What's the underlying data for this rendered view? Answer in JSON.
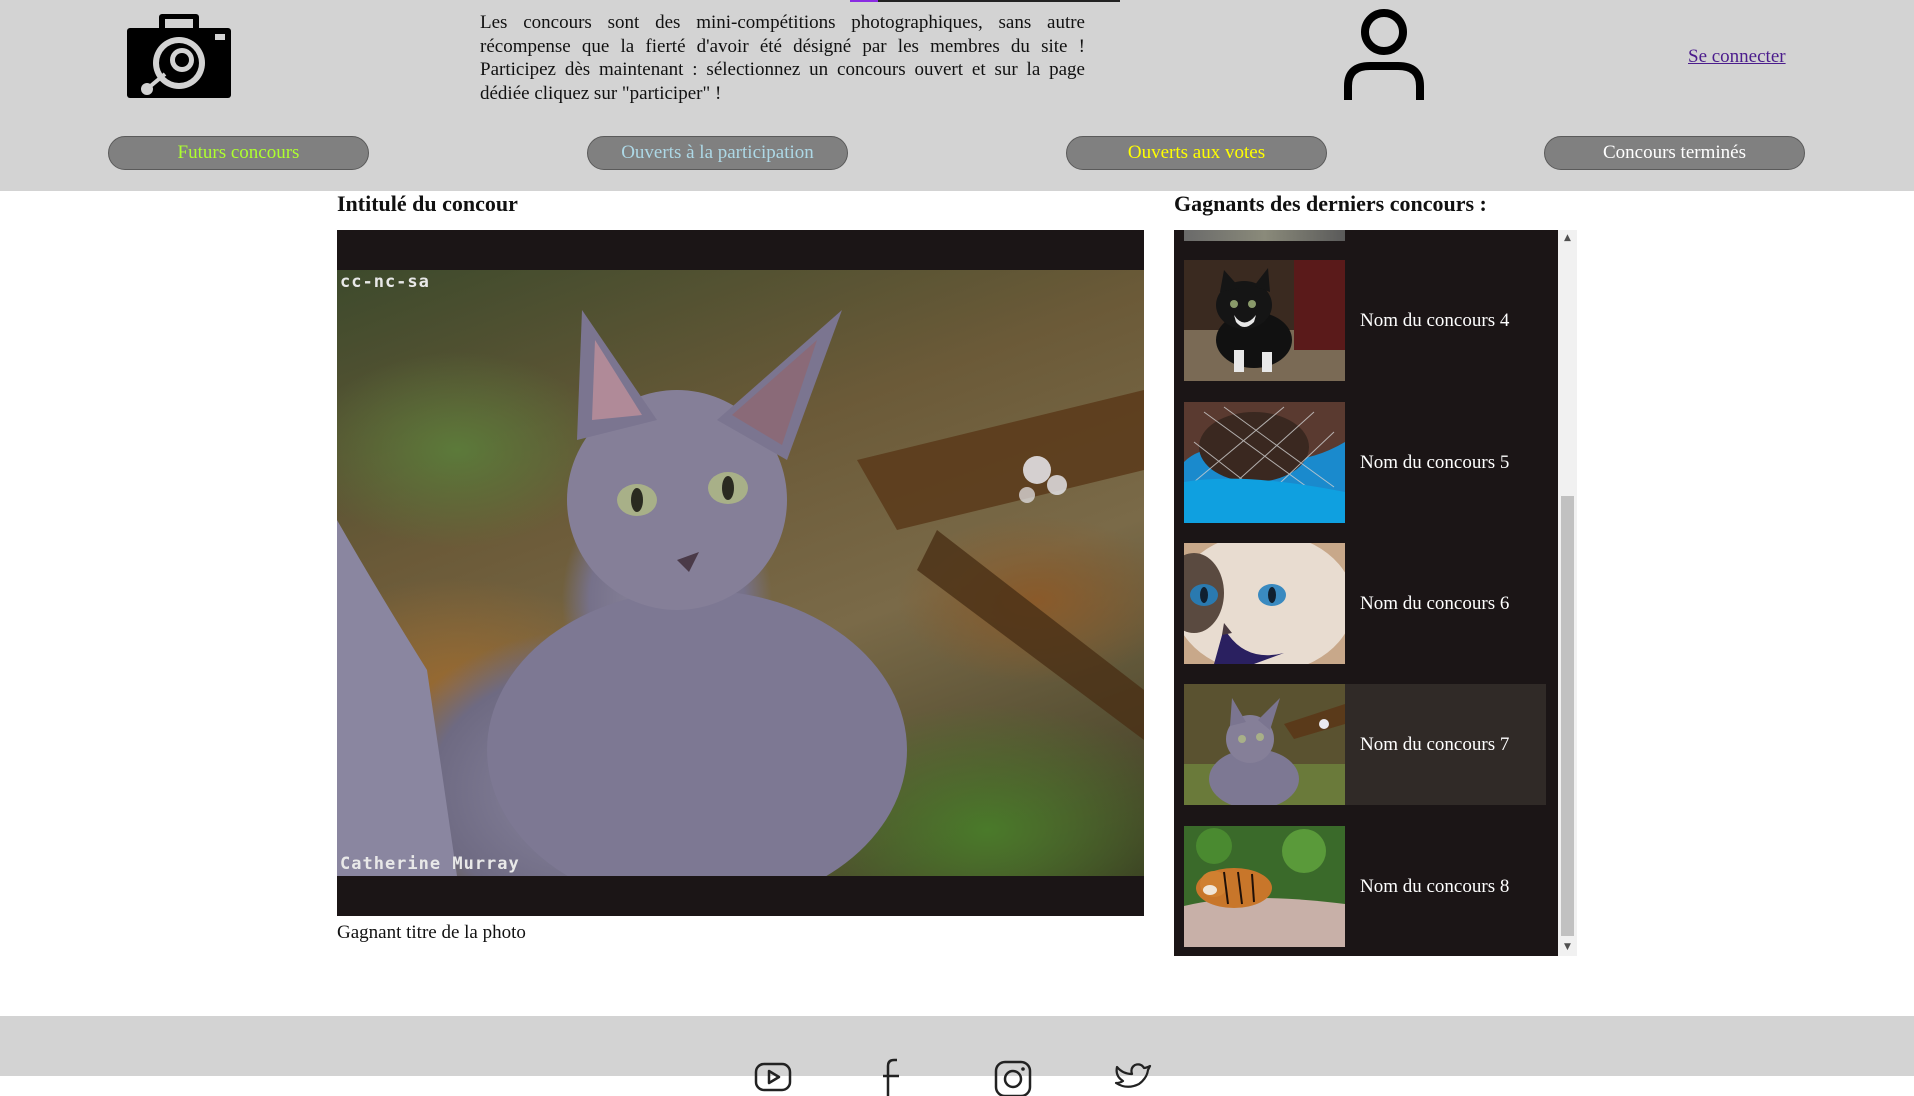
{
  "header": {
    "intro_text": "Les concours sont des mini-compétitions photographiques, sans autre récompense que la fierté d'avoir été désigné par les membres du site ! Participez dès maintenant : sélectionnez un concours ouvert et sur la page dédiée cliquez sur \"participer\" !",
    "login_label": "Se connecter",
    "logo_icon": "camera-icon",
    "user_icon": "user-icon"
  },
  "nav": {
    "tabs": [
      {
        "label": "Futurs concours",
        "color": "#adff2f"
      },
      {
        "label": "Ouverts à la participation",
        "color": "#add8e6"
      },
      {
        "label": "Ouverts aux votes",
        "color": "#ffff00"
      },
      {
        "label": "Concours terminés",
        "color": "#ffffff"
      }
    ]
  },
  "main": {
    "contest_title": "Intitulé du concour",
    "photo_license": "cc-nc-sa",
    "photo_author": "Catherine Murray",
    "photo_caption": "Gagnant titre de la photo"
  },
  "winners": {
    "title": "Gagnants des derniers concours :",
    "items": [
      {
        "name": "Nom du concours 4",
        "thumb": "black-white-kitten"
      },
      {
        "name": "Nom du concours 5",
        "thumb": "cat-in-net-blue-cloth"
      },
      {
        "name": "Nom du concours 6",
        "thumb": "blue-eyed-cat-closeup"
      },
      {
        "name": "Nom du concours 7",
        "thumb": "grey-kitten",
        "active": true
      },
      {
        "name": "Nom du concours 8",
        "thumb": "tiger-on-rock"
      }
    ]
  },
  "footer": {
    "icons": [
      "youtube-icon",
      "facebook-icon",
      "instagram-icon",
      "twitter-icon"
    ]
  }
}
